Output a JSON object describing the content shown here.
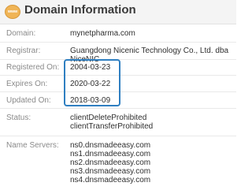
{
  "header": {
    "title": "Domain Information",
    "icon_text": "www",
    "icon": "www-globe-icon"
  },
  "rows": [
    {
      "label": "Domain:",
      "value": "mynetpharma.com"
    },
    {
      "label": "Registrar:",
      "value": "Guangdong Nicenic Technology Co., Ltd. dba NiceNIC"
    },
    {
      "label": "Registered On:",
      "value": "2004-03-23"
    },
    {
      "label": "Expires On:",
      "value": "2020-03-22"
    },
    {
      "label": "Updated On:",
      "value": "2018-03-09"
    }
  ],
  "status": {
    "label": "Status:",
    "values": [
      "clientDeleteProhibited",
      "clientTransferProhibited"
    ]
  },
  "name_servers": {
    "label": "Name Servers:",
    "values": [
      "ns0.dnsmadeeasy.com",
      "ns1.dnsmadeeasy.com",
      "ns2.dnsmadeeasy.com",
      "ns3.dnsmadeeasy.com",
      "ns4.dnsmadeeasy.com"
    ]
  },
  "colors": {
    "highlight": "#2f7fc1",
    "icon": "#f0b456"
  }
}
